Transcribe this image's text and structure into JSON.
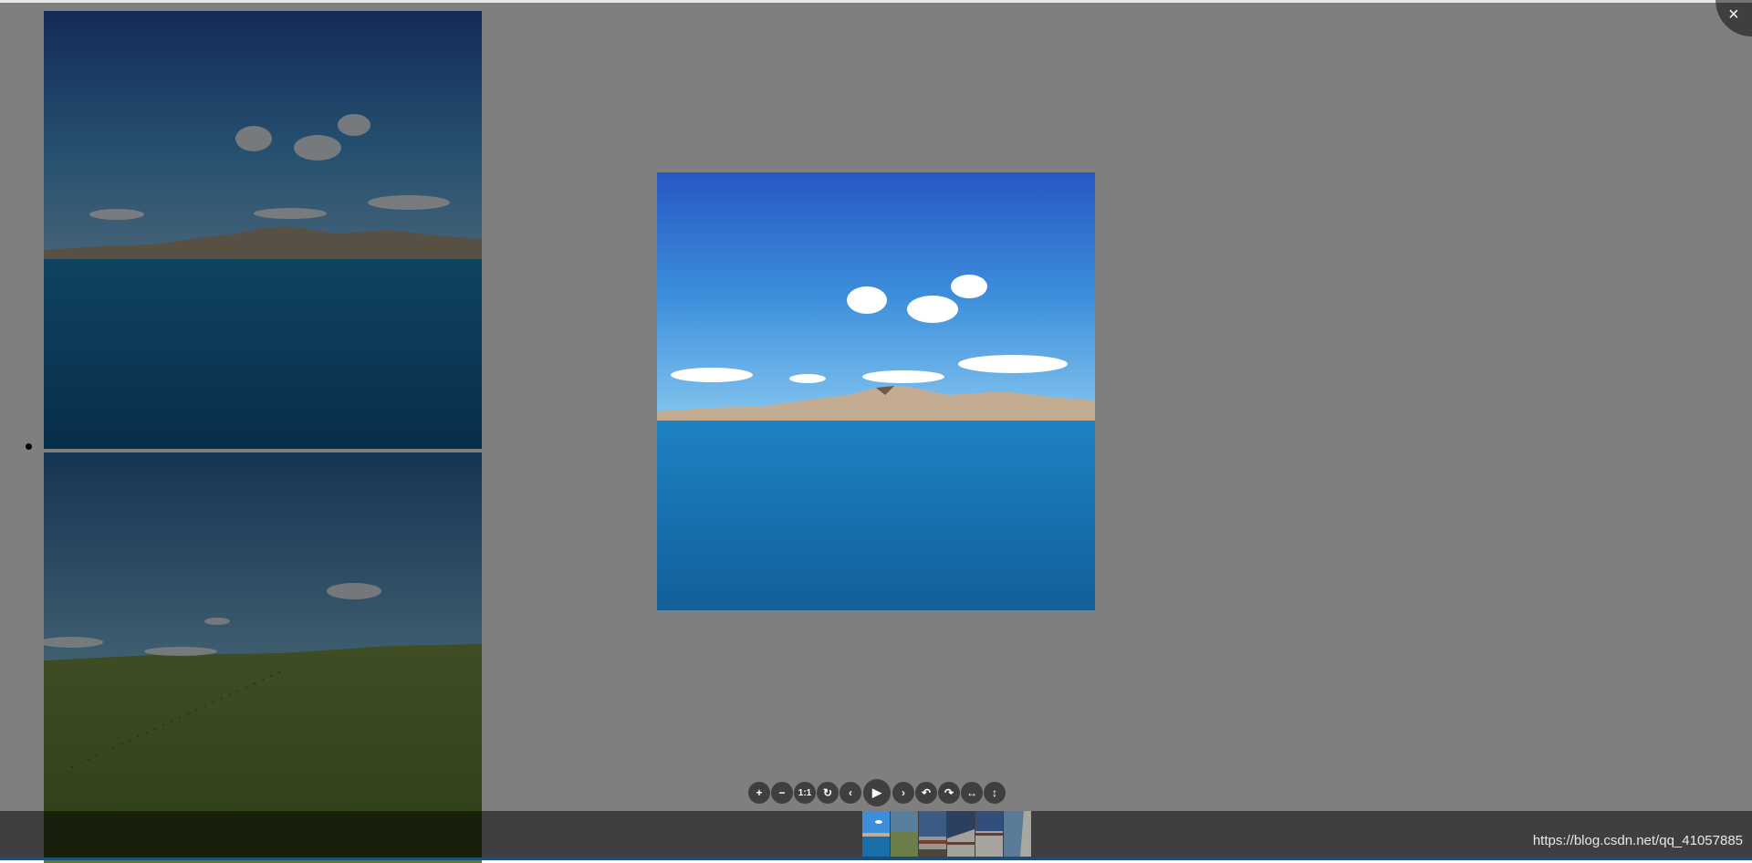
{
  "viewer": {
    "close_icon_glyph": "×",
    "toolbar": [
      {
        "name": "zoom-in-icon",
        "glyph": "+"
      },
      {
        "name": "zoom-out-icon",
        "glyph": "−"
      },
      {
        "name": "one-to-one-icon",
        "glyph": "1:1"
      },
      {
        "name": "reset-icon",
        "glyph": "↻"
      },
      {
        "name": "prev-icon",
        "glyph": "‹"
      },
      {
        "name": "play-icon",
        "glyph": "▶"
      },
      {
        "name": "next-icon",
        "glyph": "›"
      },
      {
        "name": "rotate-left-icon",
        "glyph": "↶"
      },
      {
        "name": "rotate-right-icon",
        "glyph": "↷"
      },
      {
        "name": "flip-horizontal-icon",
        "glyph": "↔"
      },
      {
        "name": "flip-vertical-icon",
        "glyph": "↕"
      }
    ],
    "thumbnails": [
      "lake-mountain",
      "grassland",
      "building-blue",
      "building-dark",
      "building-white",
      "building-edge"
    ],
    "active_thumbnail": "lake-mountain",
    "watermark": "https://blog.csdn.net/qq_41057885"
  },
  "colors": {
    "sky": "#2f74c6",
    "lake": "#1b6ea8",
    "backdrop": "rgba(0,0,0,0.5)"
  }
}
